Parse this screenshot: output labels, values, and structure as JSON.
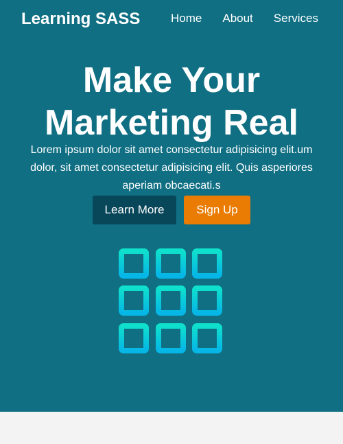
{
  "nav": {
    "brand": "Learning SASS",
    "links": [
      {
        "label": "Home"
      },
      {
        "label": "About"
      },
      {
        "label": "Services"
      }
    ]
  },
  "hero": {
    "headline_line1": "Make Your",
    "headline_line2": "Marketing Real",
    "lede": "Lorem ipsum dolor sit amet consectetur adipisicing elit.um dolor, sit amet consectetur adipisicing elit. Quis asperiores aperiam obcaecati.s",
    "learn_more_label": "Learn More",
    "sign_up_label": "Sign Up",
    "illustration_icon": "grid-icon"
  },
  "colors": {
    "hero_background": "#106f83",
    "learn_more_button": "#08465a",
    "sign_up_button": "#ea7c04",
    "icon_gradient_top": "#0fe0cc",
    "icon_gradient_bottom": "#05b6e6",
    "page_background": "#f3f3f3"
  }
}
